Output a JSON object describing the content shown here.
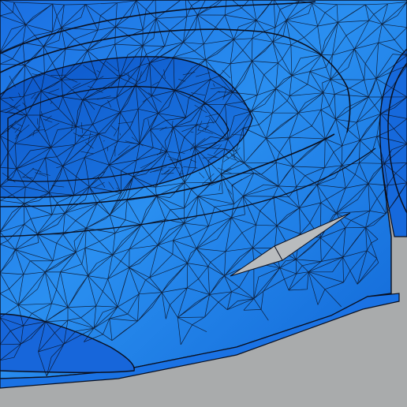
{
  "viewport": {
    "model": "car-body-mesh",
    "render_mode": "wireframe-on-shaded",
    "colors": {
      "background": "#a9abac",
      "body_light": "#2a8ff0",
      "body_mid": "#1c76e6",
      "body_dark": "#0d55c6",
      "wire": "#0a0f1e",
      "selected_face": "#b9bcbe"
    },
    "selection": {
      "count": 1,
      "element": "face",
      "highlight_color": "#b9bcbe"
    }
  }
}
